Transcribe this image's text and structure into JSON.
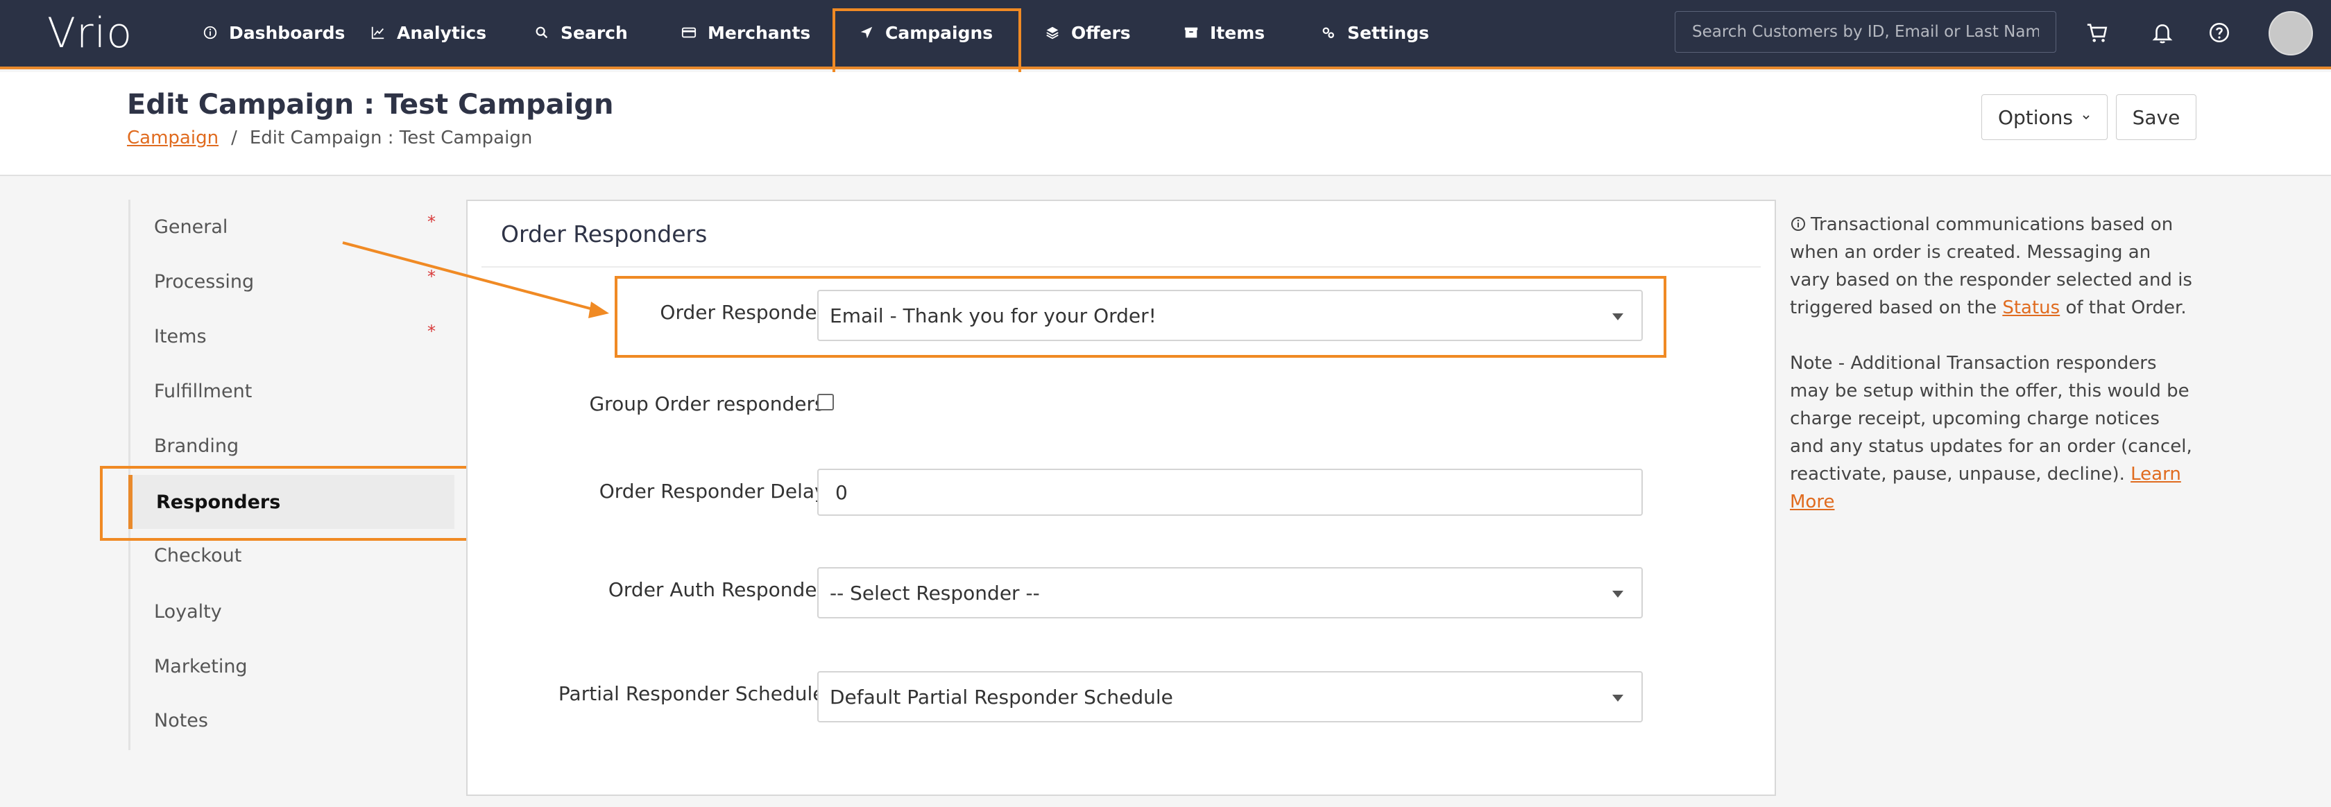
{
  "brand": {
    "logo": "Vrio",
    "accent": "#e98a2c",
    "nav_bg": "#2b3245"
  },
  "nav": {
    "items": [
      {
        "label": "Dashboards",
        "icon": "info-circle-icon"
      },
      {
        "label": "Analytics",
        "icon": "line-chart-icon"
      },
      {
        "label": "Search",
        "icon": "search-icon"
      },
      {
        "label": "Merchants",
        "icon": "card-icon"
      },
      {
        "label": "Campaigns",
        "icon": "send-icon"
      },
      {
        "label": "Offers",
        "icon": "layers-icon"
      },
      {
        "label": "Items",
        "icon": "box-icon"
      },
      {
        "label": "Settings",
        "icon": "gears-icon"
      }
    ],
    "search_placeholder": "Search Customers by ID, Email or Last Name"
  },
  "header": {
    "title": "Edit Campaign : Test Campaign",
    "breadcrumb_link": "Campaign",
    "breadcrumb_sep": "/",
    "breadcrumb_current": "Edit Campaign : Test Campaign",
    "options_label": "Options",
    "save_label": "Save"
  },
  "sidebar": {
    "items": [
      {
        "label": "General",
        "required": "*"
      },
      {
        "label": "Processing",
        "required": "*"
      },
      {
        "label": "Items",
        "required": "*"
      },
      {
        "label": "Fulfillment",
        "required": ""
      },
      {
        "label": "Branding",
        "required": ""
      },
      {
        "label": "Responders",
        "required": ""
      },
      {
        "label": "Checkout",
        "required": ""
      },
      {
        "label": "Loyalty",
        "required": ""
      },
      {
        "label": "Marketing",
        "required": ""
      },
      {
        "label": "Notes",
        "required": ""
      }
    ],
    "active": "Responders"
  },
  "panel": {
    "title": "Order Responders",
    "fields": {
      "order_responder_label": "Order Responder:",
      "order_responder_value": "Email - Thank you for your Order!",
      "group_label": "Group Order responders:",
      "delay_label": "Order Responder Delay:",
      "delay_value": "0",
      "auth_label": "Order Auth Responder:",
      "auth_value": "-- Select Responder --",
      "partial_label": "Partial Responder Schedule:",
      "partial_value": "Default Partial Responder Schedule"
    }
  },
  "help": {
    "p1_before": "Transactional communications based on when an order is created. Messaging an vary based on the responder selected and is triggered based on the ",
    "p1_link": "Status",
    "p1_after": " of that Order.",
    "p2_before": "Note - Additional Transaction responders may be setup within the offer, this would be charge receipt, upcoming charge notices and any status updates for an order (cancel, reactivate, pause, unpause, decline). ",
    "p2_link": "Learn More"
  }
}
